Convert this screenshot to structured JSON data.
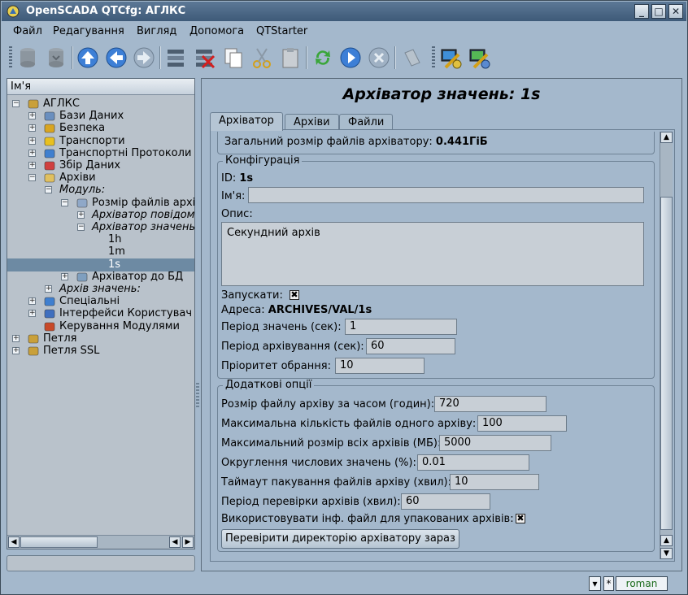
{
  "window": {
    "title": "OpenSCADA QTCfg: АГЛКС",
    "controls": {
      "minimize": "_",
      "maximize": "□",
      "close": "✕"
    }
  },
  "menu": [
    "Файл",
    "Редагування",
    "Вигляд",
    "Допомога",
    "QTStarter"
  ],
  "toolbar": {
    "icons": [
      "db-load-icon",
      "db-save-icon",
      "up-icon",
      "back-icon",
      "forward-icon",
      "add-item-icon",
      "delete-item-icon",
      "copy-icon",
      "cut-icon",
      "paste-icon",
      "refresh-icon",
      "start-icon",
      "stop-icon",
      "info-icon",
      "qtcfg-icon",
      "uiobjectgraph-icon"
    ]
  },
  "tree": {
    "header": "Ім'я",
    "items": [
      {
        "label": "АГЛКС",
        "level": 0,
        "expander": "−",
        "icon": "station-icon",
        "italic": false
      },
      {
        "label": "Бази Даних",
        "level": 1,
        "expander": "+",
        "icon": "database-icon",
        "italic": false
      },
      {
        "label": "Безпека",
        "level": 1,
        "expander": "+",
        "icon": "security-icon",
        "italic": false
      },
      {
        "label": "Транспорти",
        "level": 1,
        "expander": "+",
        "icon": "transport-icon",
        "italic": false
      },
      {
        "label": "Транспортні Протоколи",
        "level": 1,
        "expander": "+",
        "icon": "protocol-icon",
        "italic": false
      },
      {
        "label": "Збір Даних",
        "level": 1,
        "expander": "+",
        "icon": "daq-icon",
        "italic": false
      },
      {
        "label": "Архіви",
        "level": 1,
        "expander": "−",
        "icon": "archive-icon",
        "italic": false
      },
      {
        "label": "Модуль:",
        "level": 2,
        "expander": "−",
        "icon": "",
        "italic": true
      },
      {
        "label": "Розмір файлів архі",
        "level": 3,
        "expander": "−",
        "icon": "fsarch-icon",
        "italic": false
      },
      {
        "label": "Архіватор повідом",
        "level": 4,
        "expander": "+",
        "icon": "",
        "italic": true
      },
      {
        "label": "Архіватор значень",
        "level": 4,
        "expander": "−",
        "icon": "",
        "italic": true
      },
      {
        "label": "1h",
        "level": 5,
        "expander": "",
        "icon": "",
        "italic": false
      },
      {
        "label": "1m",
        "level": 5,
        "expander": "",
        "icon": "",
        "italic": false
      },
      {
        "label": "1s",
        "level": 5,
        "expander": "",
        "icon": "",
        "italic": false,
        "selected": true
      },
      {
        "label": "Архіватор до БД",
        "level": 3,
        "expander": "+",
        "icon": "dbarch-icon",
        "italic": false
      },
      {
        "label": "Архів значень:",
        "level": 2,
        "expander": "+",
        "icon": "",
        "italic": true
      },
      {
        "label": "Спеціальні",
        "level": 1,
        "expander": "+",
        "icon": "special-icon",
        "italic": false
      },
      {
        "label": "Інтерфейси Користувач",
        "level": 1,
        "expander": "+",
        "icon": "ui-icon",
        "italic": false
      },
      {
        "label": "Керування Модулями",
        "level": 1,
        "expander": "",
        "icon": "modules-icon",
        "italic": false
      },
      {
        "label": "Петля",
        "level": 0,
        "expander": "+",
        "icon": "station-icon",
        "italic": false
      },
      {
        "label": "Петля SSL",
        "level": 0,
        "expander": "+",
        "icon": "station-icon",
        "italic": false
      }
    ]
  },
  "page": {
    "title": "Архіватор значень: 1s",
    "tabs": [
      "Архіватор",
      "Архіви",
      "Файли"
    ],
    "total_size_label": "Загальний розмір файлів архіватору:",
    "total_size_value": "0.441ГіБ",
    "config": {
      "legend": "Конфігурація",
      "id_label": "ID:",
      "id_value": "1s",
      "name_label": "Ім'я:",
      "name_value": "",
      "descr_label": "Опис:",
      "descr_value": "Секундний архів",
      "start_label": "Запускати:",
      "start_value": "✖",
      "address_label": "Адреса:",
      "address_value": "ARCHIVES/VAL/1s",
      "period_label": "Період значень (сек):",
      "period_value": "1",
      "arch_period_label": "Період архівування (сек):",
      "arch_period_value": "60",
      "priority_label": "Пріоритет обрання:",
      "priority_value": "10"
    },
    "extra": {
      "legend": "Додаткові опції",
      "file_time_label": "Розмір файлу архіву за часом (годин):",
      "file_time_value": "720",
      "max_files_label": "Максимальна кількість файлів одного архіву:",
      "max_files_value": "100",
      "max_size_label": "Максимальний розмір всіх архівів (МБ):",
      "max_size_value": "5000",
      "round_label": "Округлення числових значень (%):",
      "round_value": "0.01",
      "pack_timeout_label": "Таймаут пакування файлів архіву (хвил):",
      "pack_timeout_value": "10",
      "check_period_label": "Період перевірки архівів (хвил):",
      "check_period_value": "60",
      "use_info_label": "Використовувати інф. файл для упакованих архівів:",
      "use_info_value": "✖",
      "check_button": "Перевірити директорію архіватору зараз"
    }
  },
  "statusbar": {
    "mode": "*",
    "user": "roman"
  },
  "colors": {
    "selection": "#6d8aa3",
    "window_bg": "#a4b8cc",
    "titlebar": "#4a6684"
  }
}
